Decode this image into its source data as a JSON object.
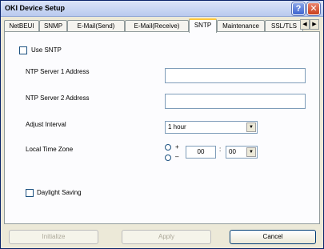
{
  "window": {
    "title": "OKI Device Setup"
  },
  "titlebar": {
    "help_label": "?",
    "close_label": "✕"
  },
  "tabs": [
    {
      "label": "NetBEUI"
    },
    {
      "label": "SNMP"
    },
    {
      "label": "E-Mail(Send)"
    },
    {
      "label": "E-Mail(Receive)"
    },
    {
      "label": "SNTP",
      "active": true
    },
    {
      "label": "Maintenance"
    },
    {
      "label": "SSL/TLS"
    }
  ],
  "tab_scroll": {
    "left": "◀",
    "right": "▶"
  },
  "form": {
    "use_sntp": {
      "label": "Use SNTP",
      "checked": false
    },
    "ntp1": {
      "label": "NTP Server 1 Address",
      "value": ""
    },
    "ntp2": {
      "label": "NTP Server 2 Address",
      "value": ""
    },
    "adjust_interval": {
      "label": "Adjust Interval",
      "value": "1 hour"
    },
    "local_time_zone": {
      "label": "Local Time Zone",
      "plus_label": "+",
      "minus_label": "–",
      "hours": "00",
      "separator": ":",
      "minutes": "00"
    },
    "daylight_saving": {
      "label": "Daylight Saving",
      "checked": false
    }
  },
  "buttons": {
    "initialize": "Initialize",
    "apply": "Apply",
    "cancel": "Cancel"
  },
  "icons": {
    "dropdown": "▼"
  },
  "colors": {
    "title_bar": "#c7d5f3",
    "active_tab_accent": "#ffc83c",
    "close_button": "#c9401d"
  }
}
